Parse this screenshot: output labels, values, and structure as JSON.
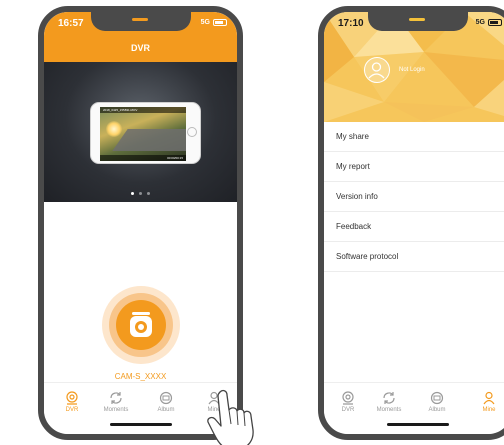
{
  "left_screen": {
    "status_time": "16:57",
    "network": "5G",
    "title": "DVR",
    "mini_screen_label": "2018_0425_155831.MOV",
    "mini_screen_time": "00:00/00:15",
    "carousel": {
      "count": 3,
      "active_index": 0
    },
    "device_name": "CAM-S_XXXX",
    "tabs": [
      {
        "label": "DVR",
        "icon": "dvr-icon",
        "active": true
      },
      {
        "label": "Moments",
        "icon": "moments-icon",
        "active": false
      },
      {
        "label": "Album",
        "icon": "album-icon",
        "active": false
      },
      {
        "label": "Mine",
        "icon": "mine-icon",
        "active": false
      }
    ]
  },
  "right_screen": {
    "status_time": "17:10",
    "network": "5G",
    "login_text": "Not Login",
    "menu_items": [
      "My share",
      "My report",
      "Version info",
      "Feedback",
      "Software protocol"
    ],
    "tabs": [
      {
        "label": "DVR",
        "icon": "dvr-icon",
        "active": false
      },
      {
        "label": "Moments",
        "icon": "moments-icon",
        "active": false
      },
      {
        "label": "Album",
        "icon": "album-icon",
        "active": false
      },
      {
        "label": "Mine",
        "icon": "mine-icon",
        "active": true
      }
    ]
  },
  "colors": {
    "accent": "#f39a1e",
    "header_yellow": "#f6c65b",
    "frame": "#4a4a4a",
    "tab_inactive": "#9a9a9a"
  }
}
